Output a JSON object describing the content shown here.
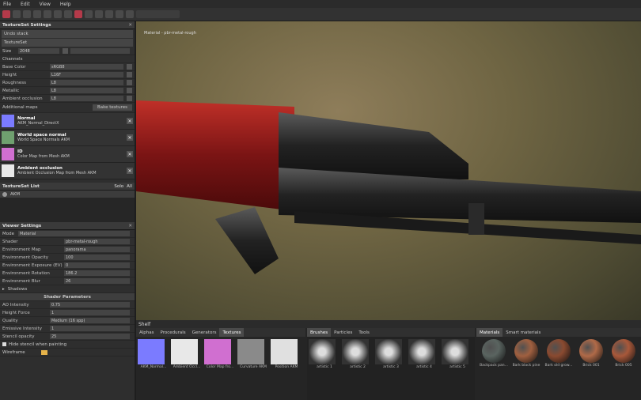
{
  "menu": [
    "File",
    "Edit",
    "View",
    "Help"
  ],
  "viewport": {
    "label": "Material - pbr-metal-rough"
  },
  "textureset_settings": {
    "title": "TextureSet Settings",
    "undo_stack": "Undo stack",
    "textureset": "TextureSet",
    "size_label": "Size",
    "size_value": "2048",
    "channels_label": "Channels",
    "channels": [
      {
        "label": "Base Color",
        "value": "sRGB8"
      },
      {
        "label": "Height",
        "value": "L16F"
      },
      {
        "label": "Roughness",
        "value": "L8"
      },
      {
        "label": "Metallic",
        "value": "L8"
      },
      {
        "label": "Ambient occlusion",
        "value": "L8"
      }
    ],
    "additional_maps": "Additional maps",
    "bake_textures": "Bake textures",
    "maps": [
      {
        "title": "Normal",
        "sub": "AKM_Normal_DirectX",
        "color": "#7b7bff"
      },
      {
        "title": "World space normal",
        "sub": "World Space Normals AKM",
        "color": "#6fa06f"
      },
      {
        "title": "ID",
        "sub": "Color Map from Mesh AKM",
        "color": "#d06fd0"
      },
      {
        "title": "Ambient occlusion",
        "sub": "Ambient Occlusion Map from Mesh AKM",
        "color": "#e8e8e8"
      }
    ]
  },
  "textureset_list": {
    "title": "TextureSet List",
    "solo": "Solo",
    "all": "All",
    "item": "AKM"
  },
  "viewer_settings": {
    "title": "Viewer Settings",
    "mode_label": "Mode",
    "mode_value": "Material",
    "rows": [
      {
        "label": "Shader",
        "value": "pbr-metal-rough"
      },
      {
        "label": "Environment Map",
        "value": "panorama"
      },
      {
        "label": "Environment Opacity",
        "value": "100"
      },
      {
        "label": "Environment Exposure (EV)",
        "value": "0"
      },
      {
        "label": "Environment Rotation",
        "value": "186.2"
      },
      {
        "label": "Environment Blur",
        "value": "26"
      }
    ],
    "shadows": "Shadows",
    "shader_params": "Shader Parameters",
    "params": [
      {
        "label": "AO Intensity",
        "value": "0.75"
      },
      {
        "label": "Height Force",
        "value": "1"
      },
      {
        "label": "Quality",
        "value": "Medium (16 spp)"
      },
      {
        "label": "Emissive Intensity",
        "value": "1"
      }
    ],
    "stencil_opacity": "Stencil opacity",
    "stencil_value": "25",
    "hide_stencil": "Hide stencil when painting",
    "wireframe": "Wireframe"
  },
  "shelf": {
    "title": "Shelf",
    "tabs1": [
      "Alphas",
      "Procedurals",
      "Generators",
      "Textures"
    ],
    "search": "Search...",
    "textures": [
      "AKM_Normal...",
      "Ambient Occl...",
      "Color Map fro...",
      "Curvature AKM",
      "Position AKM"
    ],
    "tabs2": [
      "Brushes",
      "Particles",
      "Tools"
    ],
    "brushes": [
      "artistic 1",
      "artistic 2",
      "artistic 3",
      "artistic 4",
      "artistic 5"
    ],
    "tabs3": [
      "Materials",
      "Smart materials"
    ],
    "materials": [
      "Backpack pan...",
      "Bark black pine",
      "Bark old grow...",
      "Brick 001",
      "Brick 005"
    ],
    "colors": {
      "accent": "#b43a4a",
      "wood": "#8a1818"
    }
  }
}
